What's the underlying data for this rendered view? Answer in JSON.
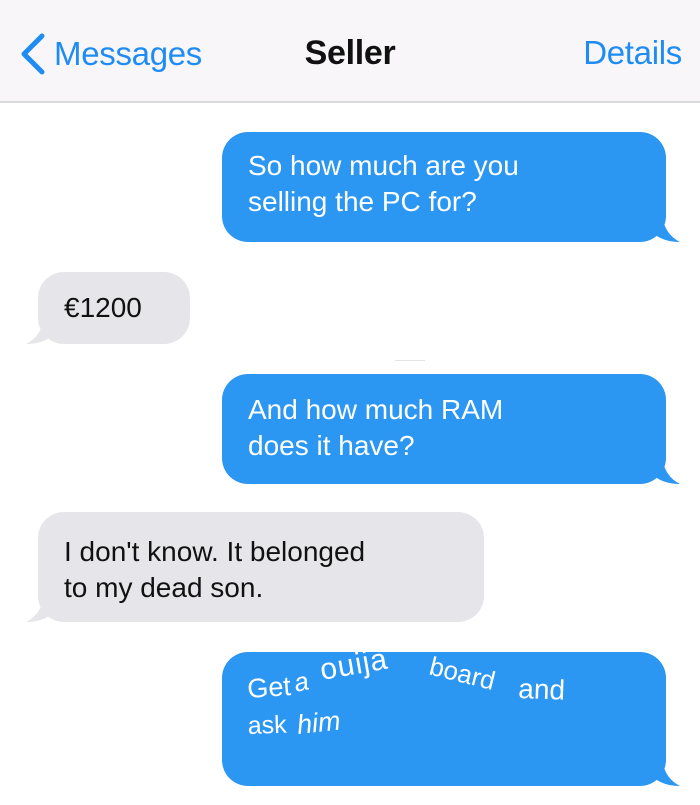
{
  "nav": {
    "back_label": "Messages",
    "title": "Seller",
    "details_label": "Details"
  },
  "messages": [
    {
      "direction": "sent",
      "lines": [
        "So how much are you",
        "selling the PC for?"
      ]
    },
    {
      "direction": "received",
      "lines": [
        "€1200"
      ]
    },
    {
      "direction": "sent",
      "lines": [
        "And how much RAM",
        "does it have?"
      ]
    },
    {
      "direction": "received",
      "lines": [
        "I don't know. It belonged",
        "to my dead son."
      ]
    },
    {
      "direction": "sent",
      "words": [
        "Get",
        "a",
        "ouija",
        "board",
        "and",
        "ask",
        "him"
      ]
    }
  ],
  "colors": {
    "accent": "#1f8cf3",
    "sent_bubble": "#2c97f2",
    "received_bubble": "#e6e5ea"
  },
  "icons": {
    "back": "chevron-left-icon"
  }
}
